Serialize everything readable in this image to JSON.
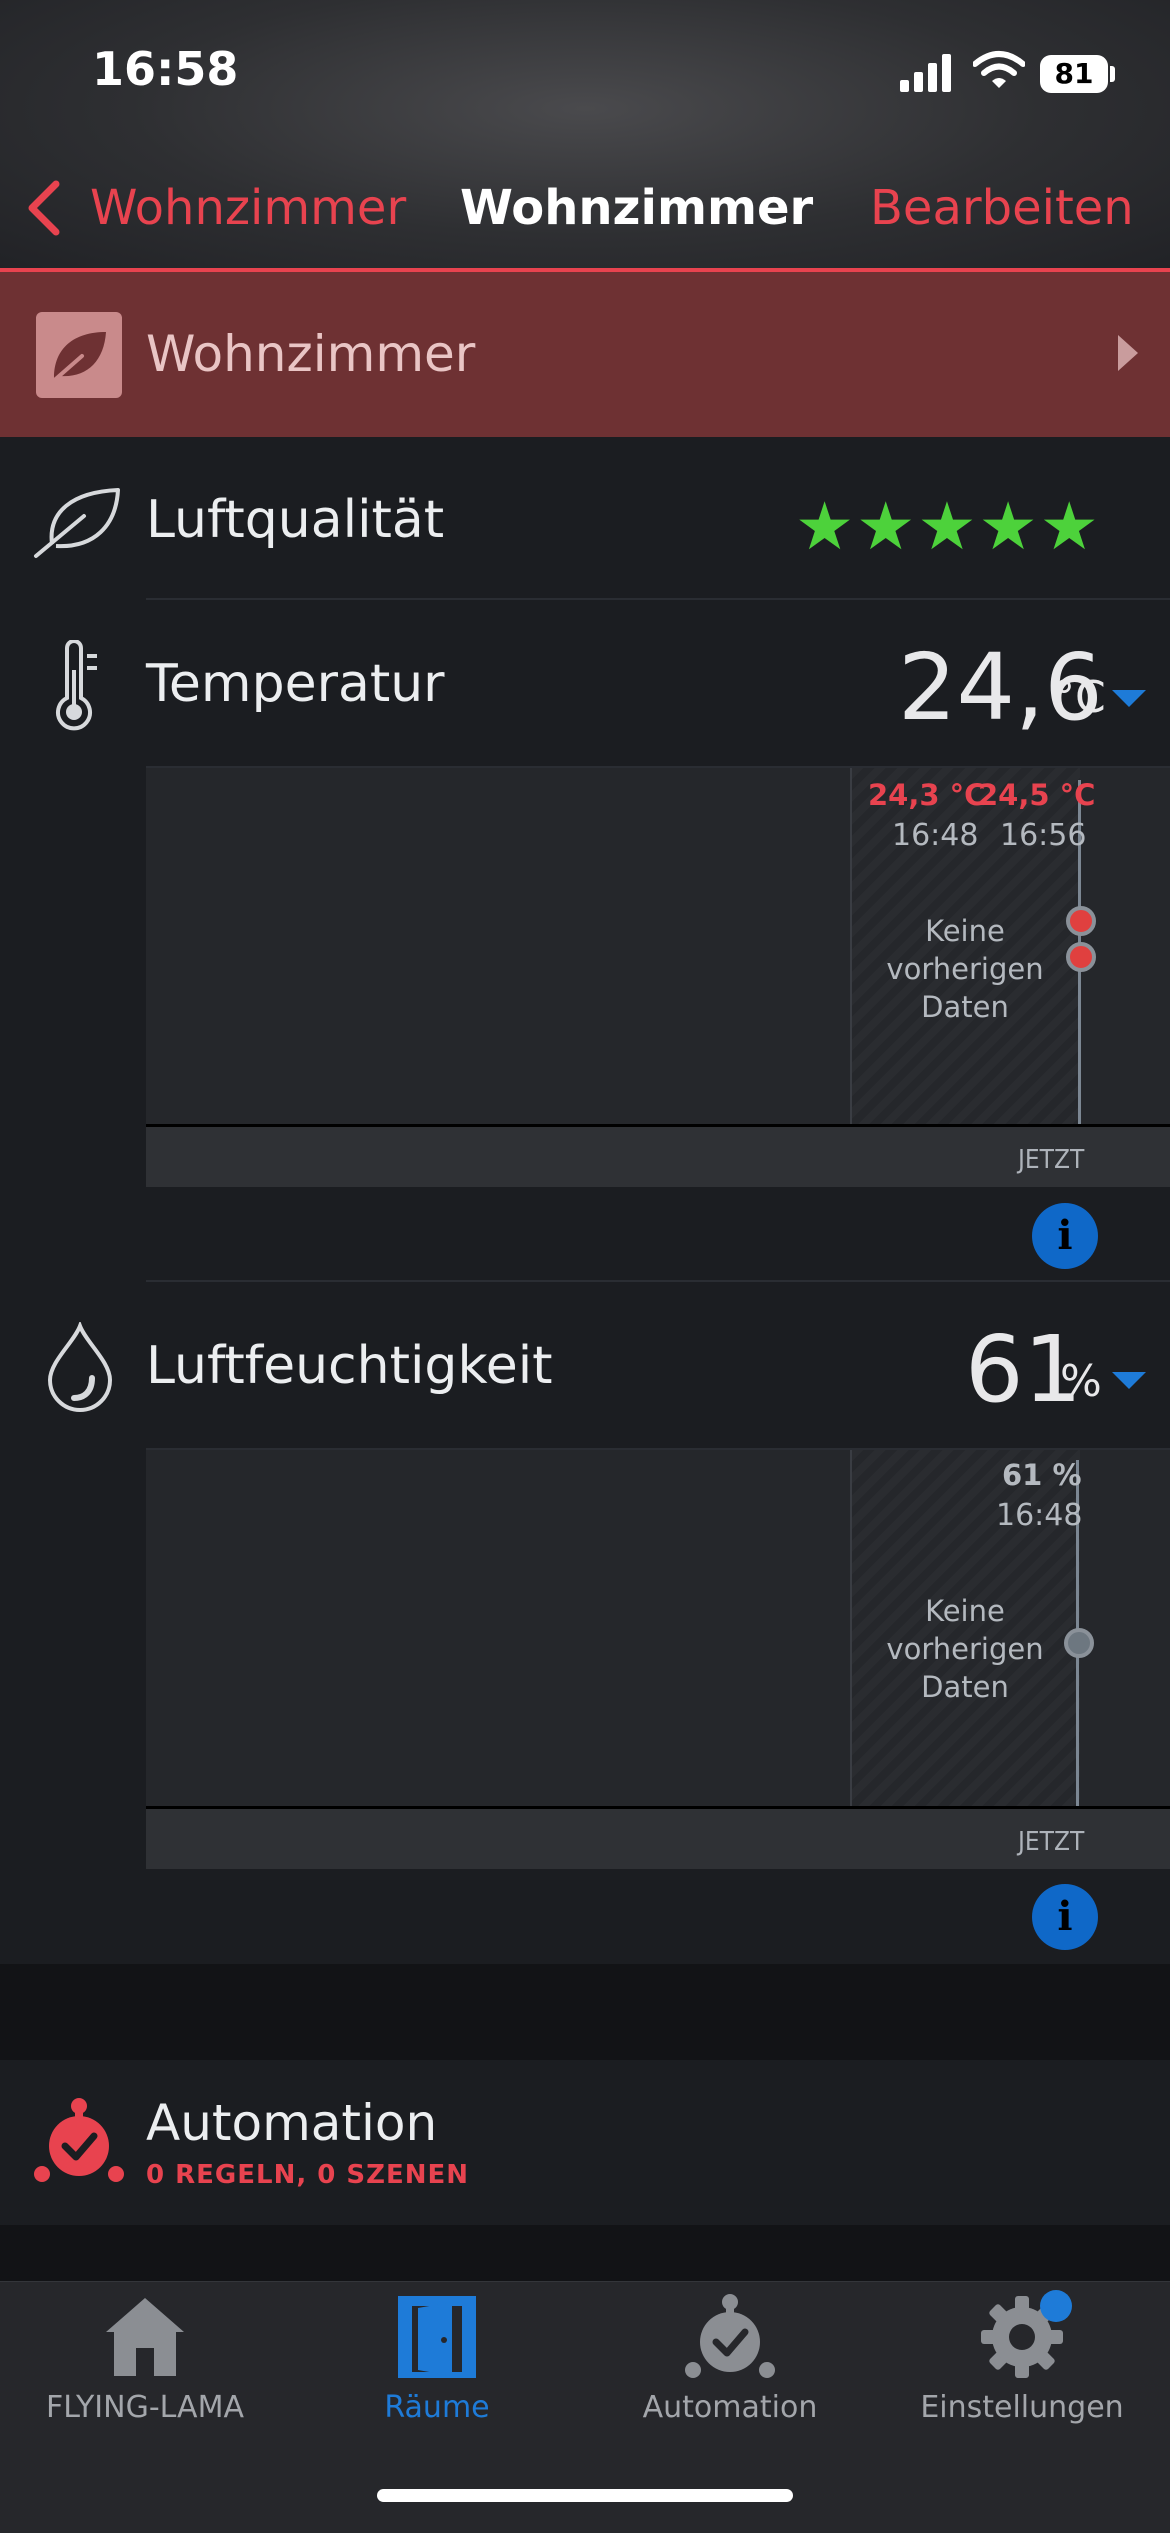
{
  "status_bar": {
    "time": "16:58",
    "battery": "81"
  },
  "nav": {
    "back_label": "Wohnzimmer",
    "title": "Wohnzimmer",
    "edit_label": "Bearbeiten",
    "accent": "#e8434f"
  },
  "room": {
    "label": "Wohnzimmer",
    "icon": "leaf-icon"
  },
  "air_quality": {
    "label": "Luftqualität",
    "stars": "★★★★★",
    "rating": 5,
    "max_rating": 5,
    "star_color": "#4dd23b"
  },
  "temperature": {
    "label": "Temperatur",
    "value": "24,6",
    "unit": "°C",
    "chart": {
      "readings": [
        {
          "value": "24,3 °C",
          "time": "16:48"
        },
        {
          "value": "24,5 °C",
          "time": "16:56"
        }
      ],
      "no_data": "Keine vorherigen Daten",
      "axis_now": "JETZT"
    },
    "info_icon": "i"
  },
  "humidity": {
    "label": "Luftfeuchtigkeit",
    "value": "61",
    "unit": "%",
    "chart": {
      "readings": [
        {
          "value": "61 %",
          "time": "16:48"
        }
      ],
      "no_data": "Keine vorherigen Daten",
      "axis_now": "JETZT"
    },
    "info_icon": "i"
  },
  "automation": {
    "label": "Automation",
    "subtitle": "0 REGELN, 0 SZENEN"
  },
  "tabs": [
    {
      "label": "FLYING-LAMA",
      "icon": "home-icon",
      "active": false
    },
    {
      "label": "Räume",
      "icon": "door-icon",
      "active": true
    },
    {
      "label": "Automation",
      "icon": "alarm-clock-icon",
      "active": false
    },
    {
      "label": "Einstellungen",
      "icon": "gear-icon",
      "active": false
    }
  ],
  "colors": {
    "active_tab": "#1e7bd8",
    "background": "#1b1d21"
  }
}
